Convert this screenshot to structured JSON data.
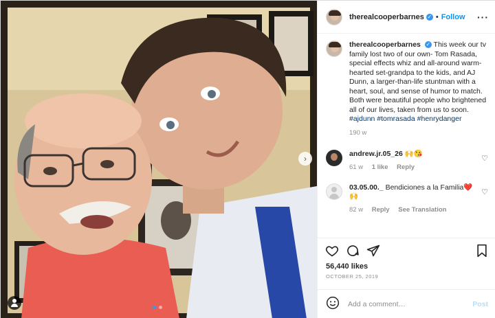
{
  "header": {
    "username": "therealcooperbarnes",
    "separator": "•",
    "follow_label": "Follow",
    "more_icon": "more-horizontal-icon"
  },
  "caption": {
    "username": "therealcooperbarnes",
    "text": "This week our tv family lost two of our own- Tom Rasada, special effects whiz and all-around warm-hearted set-grandpa to the kids, and AJ Dunn, a larger-than-life stuntman with a heart, soul, and sense of humor to match. Both were beautiful people who brightened all of our lives, taken from us to soon.",
    "hashtags": "#ajdunn #tomrasada #henrydanger",
    "age": "190 w"
  },
  "comments": [
    {
      "username": "andrew.jr.05_26",
      "text": "🙌😘",
      "age": "61 w",
      "likes": "1 like",
      "reply": "Reply"
    },
    {
      "username": "03.05.00._",
      "text": "Bendiciones a la Familia❤️🙌",
      "age": "82 w",
      "reply": "Reply",
      "translate": "See Translation"
    }
  ],
  "likes": "56,440 likes",
  "date": "OCTOBER 25, 2019",
  "add_comment": {
    "placeholder": "Add a comment…",
    "post_label": "Post"
  },
  "icons": {
    "like": "heart-icon",
    "comment": "comment-icon",
    "share": "send-icon",
    "save": "bookmark-icon",
    "emoji": "emoji-icon"
  },
  "colors": {
    "accent": "#0095f6",
    "verified": "#3897f0",
    "muted": "#8e8e8e"
  }
}
